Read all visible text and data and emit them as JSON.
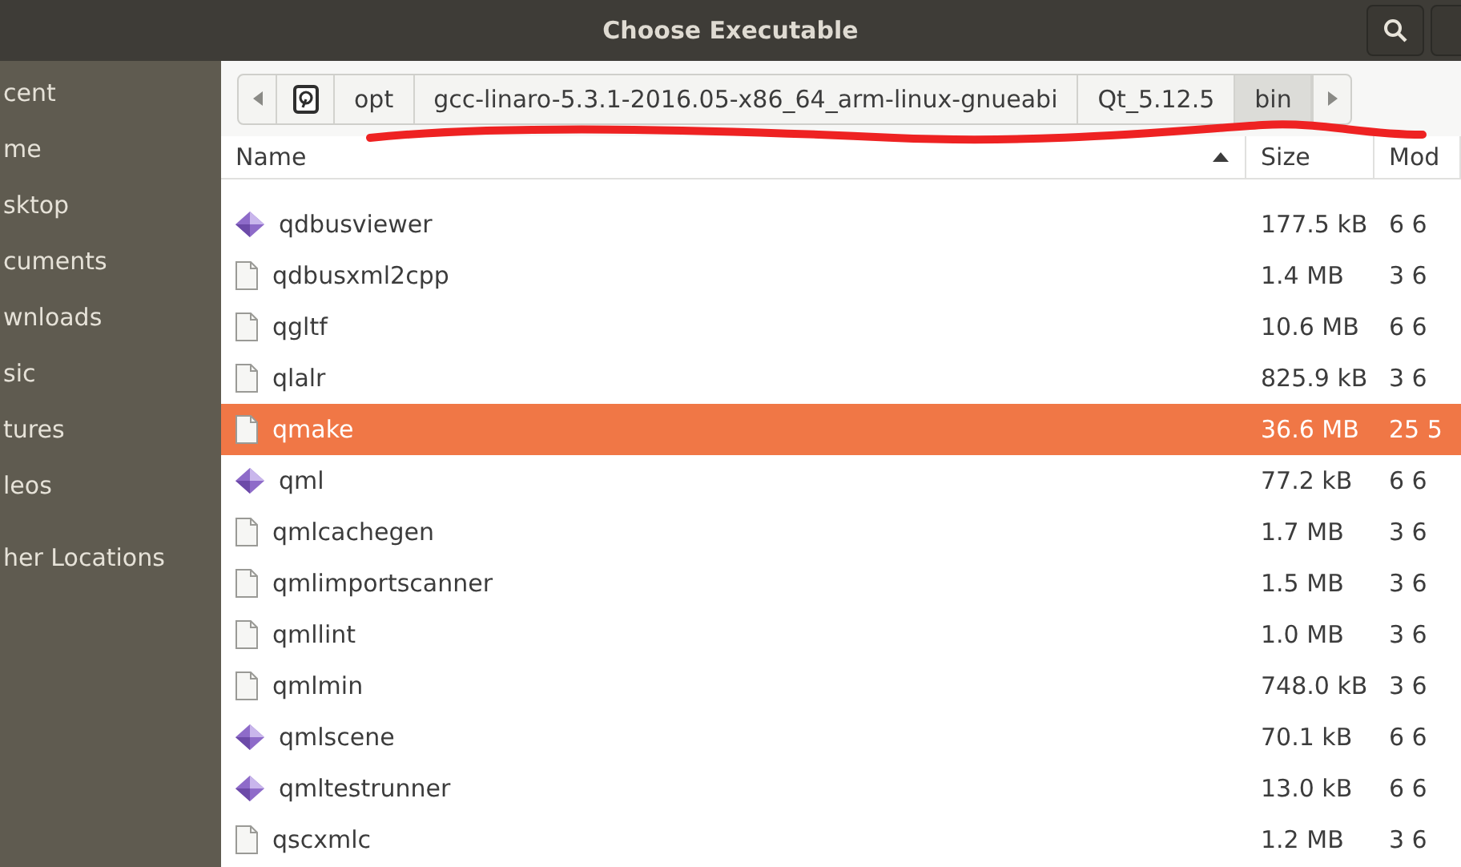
{
  "window": {
    "title": "Choose Executable"
  },
  "sidebar": {
    "items": [
      {
        "label": "cent"
      },
      {
        "label": "me"
      },
      {
        "label": "sktop"
      },
      {
        "label": "cuments"
      },
      {
        "label": "wnloads"
      },
      {
        "label": "sic"
      },
      {
        "label": "tures"
      },
      {
        "label": "leos"
      },
      {
        "label": "her Locations",
        "kind": "other"
      }
    ]
  },
  "path_bar": {
    "segments": [
      {
        "label": "opt",
        "selected": false
      },
      {
        "label": "gcc-linaro-5.3.1-2016.05-x86_64_arm-linux-gnueabi",
        "selected": false
      },
      {
        "label": "Qt_5.12.5",
        "selected": false
      },
      {
        "label": "bin",
        "selected": true
      }
    ]
  },
  "table": {
    "columns": [
      "Name",
      "Size",
      "Mod"
    ],
    "rows": [
      {
        "kind": "app",
        "name": "qdbusviewer",
        "size": "177.5 kB",
        "modified": "6 6",
        "selected": false
      },
      {
        "kind": "file",
        "name": "qdbusxml2cpp",
        "size": "1.4 MB",
        "modified": "3 6",
        "selected": false
      },
      {
        "kind": "file",
        "name": "qgltf",
        "size": "10.6 MB",
        "modified": "6 6",
        "selected": false
      },
      {
        "kind": "file",
        "name": "qlalr",
        "size": "825.9 kB",
        "modified": "3 6",
        "selected": false
      },
      {
        "kind": "file",
        "name": "qmake",
        "size": "36.6 MB",
        "modified": "25 5",
        "selected": true
      },
      {
        "kind": "app",
        "name": "qml",
        "size": "77.2 kB",
        "modified": "6 6",
        "selected": false
      },
      {
        "kind": "file",
        "name": "qmlcachegen",
        "size": "1.7 MB",
        "modified": "3 6",
        "selected": false
      },
      {
        "kind": "file",
        "name": "qmlimportscanner",
        "size": "1.5 MB",
        "modified": "3 6",
        "selected": false
      },
      {
        "kind": "file",
        "name": "qmllint",
        "size": "1.0 MB",
        "modified": "3 6",
        "selected": false
      },
      {
        "kind": "file",
        "name": "qmlmin",
        "size": "748.0 kB",
        "modified": "3 6",
        "selected": false
      },
      {
        "kind": "app",
        "name": "qmlscene",
        "size": "70.1 kB",
        "modified": "6 6",
        "selected": false
      },
      {
        "kind": "app",
        "name": "qmltestrunner",
        "size": "13.0 kB",
        "modified": "6 6",
        "selected": false
      },
      {
        "kind": "file",
        "name": "qscxmlc",
        "size": "1.2 MB",
        "modified": "3 6",
        "selected": false
      }
    ]
  }
}
